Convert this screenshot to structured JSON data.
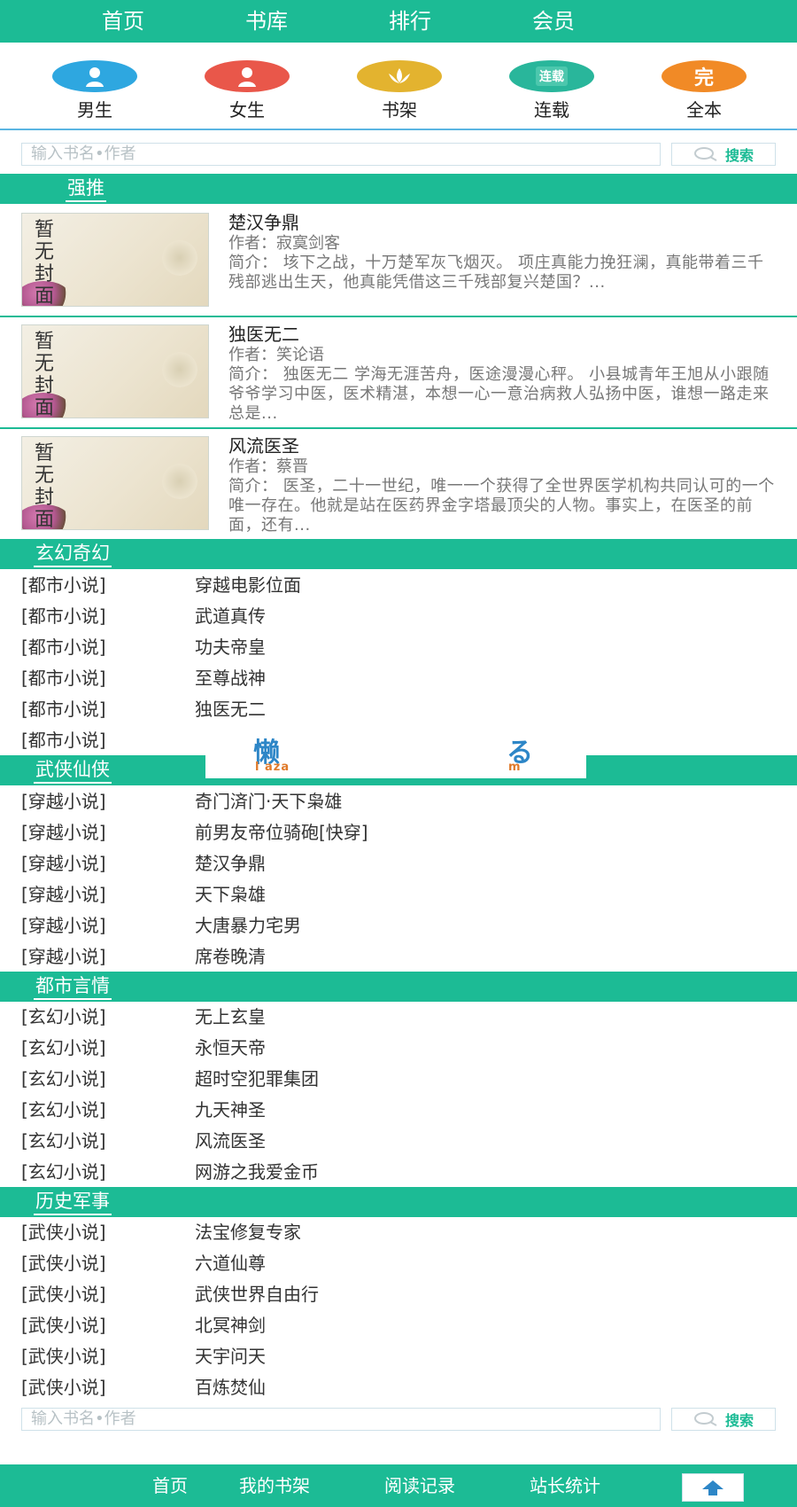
{
  "nav": {
    "items": [
      "首页",
      "书库",
      "排行",
      "会员"
    ]
  },
  "categories": [
    {
      "label": "男生",
      "color": "#2ea7e0",
      "icon": "person-icon"
    },
    {
      "label": "女生",
      "color": "#e9574a",
      "icon": "person-icon"
    },
    {
      "label": "书架",
      "color": "#e3b32f",
      "icon": "lotus-icon",
      "badge": ""
    },
    {
      "label": "连载",
      "color": "#29b69b",
      "icon": "serial-icon",
      "badge": "连载"
    },
    {
      "label": "全本",
      "color": "#f18a26",
      "icon": "complete-icon",
      "badge": "完"
    }
  ],
  "search": {
    "placeholder": "输入书名•作者",
    "button_label": "搜索"
  },
  "featured": {
    "title": "强推",
    "books": [
      {
        "cover_text": "暂无封面",
        "title": "楚汉争鼎",
        "author": "作者：寂寞剑客",
        "intro": "简介： 垓下之战，十万楚军灰飞烟灭。 项庄真能力挽狂澜，真能带着三千残部逃出生天，他真能凭借这三千残部复兴楚国？..."
      },
      {
        "cover_text": "暂无封面",
        "title": "独医无二",
        "author": "作者：笑论语",
        "intro": "简介： 独医无二 学海无涯苦舟，医途漫漫心秤。 小县城青年王旭从小跟随爷爷学习中医，医术精湛，本想一心一意治病救人弘扬中医，谁想一路走来总是..."
      },
      {
        "cover_text": "暂无封面",
        "title": "风流医圣",
        "author": "作者：蔡晋",
        "intro": "简介： 医圣，二十一世纪，唯一一个获得了全世界医学机构共同认可的一个唯一存在。他就是站在医药界金字塔最顶尖的人物。事实上，在医圣的前面，还有..."
      }
    ]
  },
  "sections": [
    {
      "title": "玄幻奇幻",
      "items": [
        {
          "tag": "[都市小说]",
          "name": "穿越电影位面"
        },
        {
          "tag": "[都市小说]",
          "name": "武道真传"
        },
        {
          "tag": "[都市小说]",
          "name": "功夫帝皇"
        },
        {
          "tag": "[都市小说]",
          "name": "至尊战神"
        },
        {
          "tag": "[都市小说]",
          "name": "独医无二"
        },
        {
          "tag": "[都市小说]",
          "name": ""
        }
      ]
    },
    {
      "title": "武侠仙侠",
      "items": [
        {
          "tag": "[穿越小说]",
          "name": "奇门済门·天下枭雄"
        },
        {
          "tag": "[穿越小说]",
          "name": "前男友帝位骑砲[快穿]"
        },
        {
          "tag": "[穿越小说]",
          "name": "楚汉争鼎"
        },
        {
          "tag": "[穿越小说]",
          "name": "天下枭雄"
        },
        {
          "tag": "[穿越小说]",
          "name": "大唐暴力宅男"
        },
        {
          "tag": "[穿越小说]",
          "name": "席卷晚清"
        }
      ]
    },
    {
      "title": "都市言情",
      "items": [
        {
          "tag": "[玄幻小说]",
          "name": "无上玄皇"
        },
        {
          "tag": "[玄幻小说]",
          "name": "永恒天帝"
        },
        {
          "tag": "[玄幻小说]",
          "name": "超时空犯罪集团"
        },
        {
          "tag": "[玄幻小说]",
          "name": "九天神圣"
        },
        {
          "tag": "[玄幻小说]",
          "name": "风流医圣"
        },
        {
          "tag": "[玄幻小说]",
          "name": "网游之我爱金币"
        }
      ]
    },
    {
      "title": "历史军事",
      "items": [
        {
          "tag": "[武侠小说]",
          "name": "法宝修复专家"
        },
        {
          "tag": "[武侠小说]",
          "name": "六道仙尊"
        },
        {
          "tag": "[武侠小说]",
          "name": "武侠世界自由行"
        },
        {
          "tag": "[武侠小说]",
          "name": "北冥神剑"
        },
        {
          "tag": "[武侠小说]",
          "name": "天宇问天"
        },
        {
          "tag": "[武侠小说]",
          "name": "百炼焚仙"
        }
      ]
    }
  ],
  "overlay": {
    "logo_main": "懒",
    "logo_sub": "l aza",
    "logo_right": "る",
    "logo_right_sub": "m"
  },
  "footer": {
    "links": [
      "首页",
      "我的书架",
      "阅读记录",
      "站长统计"
    ]
  },
  "colors": {
    "accent": "#1cbb95",
    "search_button_text": "#1cbb95"
  }
}
